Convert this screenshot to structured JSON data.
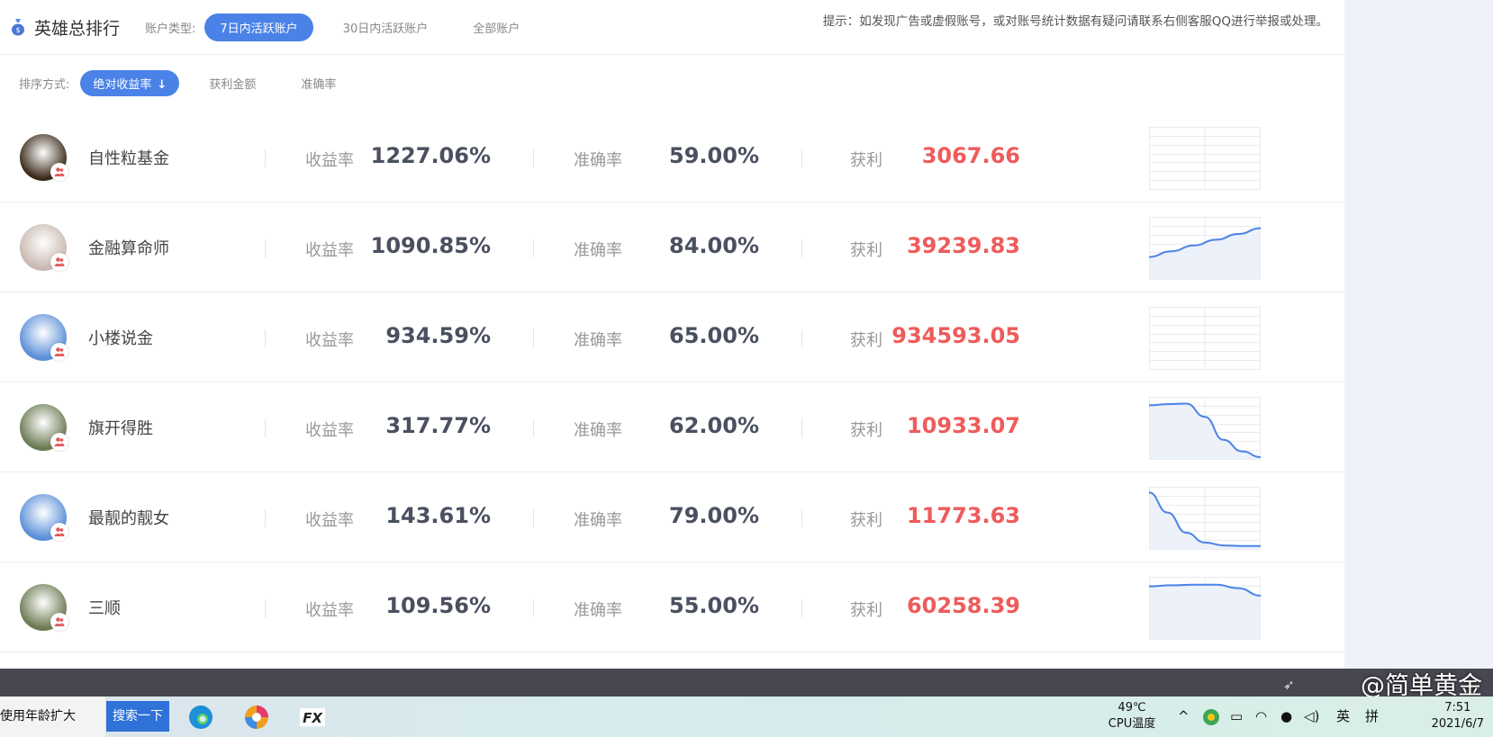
{
  "header": {
    "title": "英雄总排行",
    "account_type_label": "账户类型:",
    "account_tabs": [
      "7日内活跃账户",
      "30日内活跃账户",
      "全部账户"
    ],
    "active_account_tab": 0,
    "notice": "提示：如发现广告或虚假账号，或对账号统计数据有疑问请联系右侧客服QQ进行举报或处理。"
  },
  "sort": {
    "label": "排序方式:",
    "options": [
      "绝对收益率",
      "获利金额",
      "准确率"
    ],
    "active_option": 0,
    "active_icon": "arrow-down-icon"
  },
  "metric_labels": {
    "return": "收益率",
    "accuracy": "准确率",
    "profit": "获利"
  },
  "rows": [
    {
      "name": "自性粒基金",
      "return": "1227.06%",
      "accuracy": "59.00%",
      "profit": "3067.66",
      "trend": []
    },
    {
      "name": "金融算命师",
      "return": "1090.85%",
      "accuracy": "84.00%",
      "profit": "39239.83",
      "trend": [
        0.35,
        0.45,
        0.55,
        0.65,
        0.75,
        0.85
      ]
    },
    {
      "name": "小楼说金",
      "return": "934.59%",
      "accuracy": "65.00%",
      "profit": "934593.05",
      "trend": []
    },
    {
      "name": "旗开得胜",
      "return": "317.77%",
      "accuracy": "62.00%",
      "profit": "10933.07",
      "trend": [
        0.9,
        0.92,
        0.93,
        0.7,
        0.3,
        0.1,
        0.0
      ]
    },
    {
      "name": "最靓的靓女",
      "return": "143.61%",
      "accuracy": "79.00%",
      "profit": "11773.63",
      "trend": [
        0.95,
        0.6,
        0.25,
        0.08,
        0.03,
        0.02,
        0.02
      ]
    },
    {
      "name": "三顺",
      "return": "109.56%",
      "accuracy": "55.00%",
      "profit": "60258.39",
      "trend": [
        0.88,
        0.9,
        0.91,
        0.91,
        0.85,
        0.72
      ]
    }
  ],
  "colors": {
    "accent": "#4a82e8",
    "profit": "#ef5b5b",
    "spark_line": "#4a82e8",
    "spark_fill": "#e7edf9"
  },
  "watermark": "@简单黄金",
  "taskbar": {
    "search_text": "使用年龄扩大",
    "search_button": "搜索一下",
    "cpu_temp": "49℃",
    "cpu_label": "CPU温度",
    "ime_lang": "英",
    "ime_mode": "拼",
    "time": "7:51",
    "date": "2021/6/7"
  }
}
